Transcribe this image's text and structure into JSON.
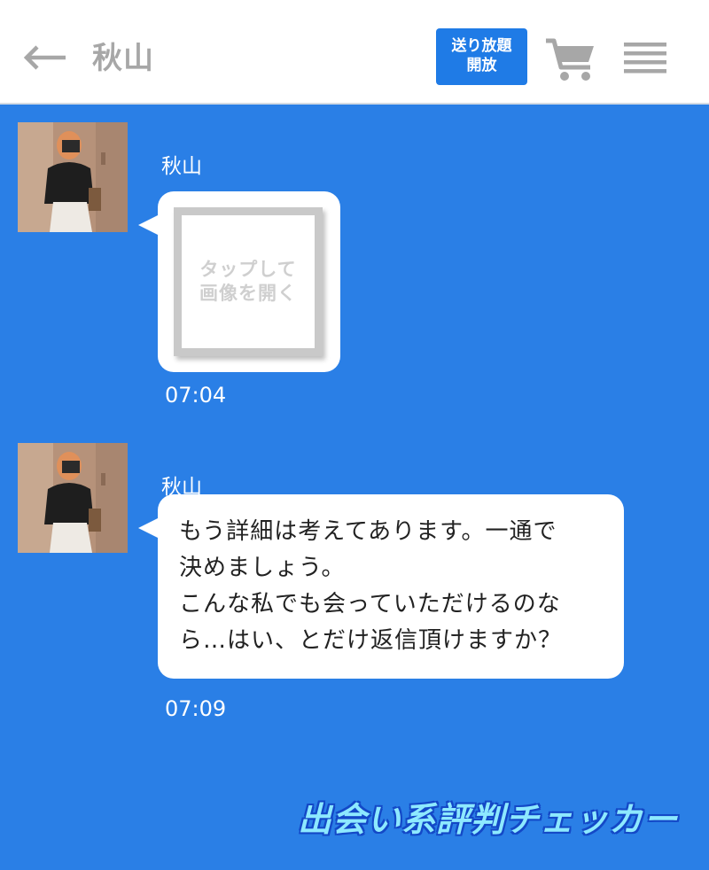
{
  "header": {
    "back_icon": "back-arrow-icon",
    "title": "秋山",
    "unlimited_button": {
      "line1": "送り放題",
      "line2": "開放"
    },
    "cart_icon": "cart-icon",
    "menu_icon": "hamburger-menu-icon"
  },
  "colors": {
    "chat_background": "#2a7fe6",
    "header_background": "#ffffff",
    "accent_button": "#1f7be6",
    "bubble": "#ffffff",
    "watermark": "#8de9ff"
  },
  "messages": [
    {
      "sender": "秋山",
      "type": "image",
      "image_placeholder": {
        "line1": "タップして",
        "line2": "画像を開く"
      },
      "time": "07:04"
    },
    {
      "sender": "秋山",
      "type": "text",
      "lines": [
        "もう詳細は考えてあります。一通で",
        "決めましょう。",
        "こんな私でも会っていただけるのな",
        "ら…はい、とだけ返信頂けますか？"
      ],
      "time": "07:09"
    }
  ],
  "watermark": "出会い系評判チェッカー"
}
